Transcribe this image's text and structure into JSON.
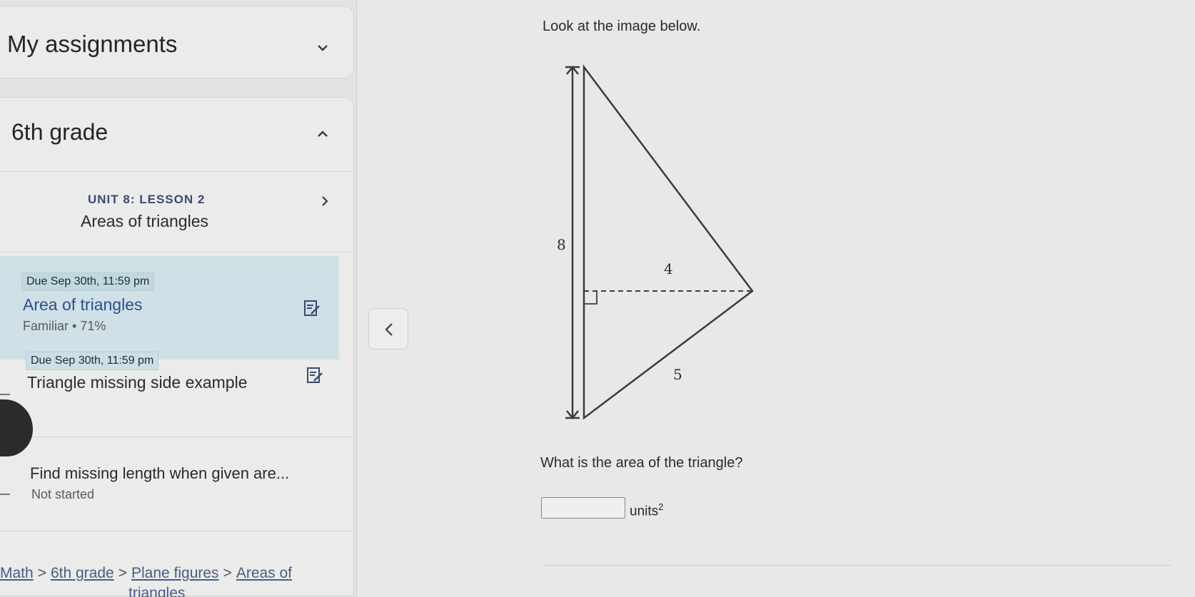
{
  "sidebar": {
    "assignments_title": "My assignments",
    "grade_title": "6th grade",
    "unit": {
      "label": "UNIT 8: LESSON 2",
      "title": "Areas of triangles"
    },
    "items": [
      {
        "due": "Due Sep 30th, 11:59 pm",
        "title": "Area of triangles",
        "status": "Familiar • 71%",
        "icon": "edit-icon"
      },
      {
        "due": "Due Sep 30th, 11:59 pm",
        "title": "Triangle missing side example",
        "icon": "edit-icon"
      },
      {
        "title": "Find missing length when given are...",
        "status": "Not started"
      }
    ],
    "breadcrumb": {
      "items": [
        "Math",
        "6th grade",
        "Plane figures",
        "Areas of"
      ],
      "continuation": "triangles",
      "separator": ">"
    }
  },
  "main": {
    "prompt": "Look at the image below.",
    "figure": {
      "label_height": "8",
      "label_side_top": "4",
      "label_side_bottom": "5"
    },
    "question": "What is the area of the triangle?",
    "answer": {
      "value": "",
      "units": "units",
      "units_sup": "2"
    }
  },
  "colors": {
    "active_row": "#cfe0e6",
    "link": "#4a5b86",
    "unit_label": "#3c4a72"
  }
}
